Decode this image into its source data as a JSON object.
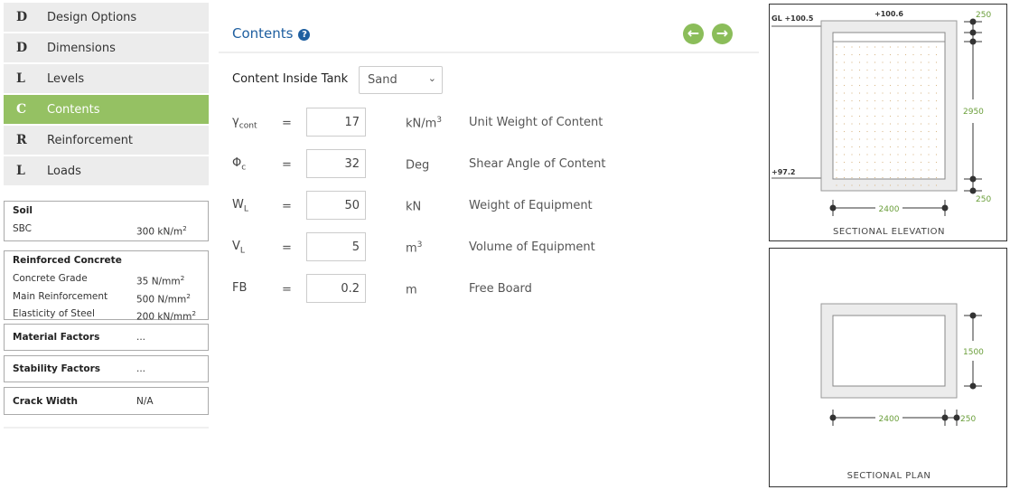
{
  "sidebar": {
    "items": [
      {
        "letter": "D",
        "label": "Design Options",
        "active": false
      },
      {
        "letter": "D",
        "label": "Dimensions",
        "active": false
      },
      {
        "letter": "L",
        "label": "Levels",
        "active": false
      },
      {
        "letter": "C",
        "label": "Contents",
        "active": true
      },
      {
        "letter": "R",
        "label": "Reinforcement",
        "active": false
      },
      {
        "letter": "L",
        "label": "Loads",
        "active": false
      }
    ],
    "soil": {
      "title": "Soil",
      "label": "SBC",
      "value": "300 kN/m",
      "sup": "2"
    },
    "rc": {
      "title": "Reinforced Concrete",
      "rows": [
        {
          "label": "Concrete Grade",
          "value": "35 N/mm",
          "sup": "2"
        },
        {
          "label": "Main Reinforcement",
          "value": "500 N/mm",
          "sup": "2"
        },
        {
          "label": "Elasticity of Steel",
          "value": "200 kN/mm",
          "sup": "2"
        }
      ]
    },
    "material": {
      "title": "Material Factors",
      "value": "..."
    },
    "stability": {
      "title": "Stability Factors",
      "value": "..."
    },
    "crack": {
      "title": "Crack Width",
      "value": "N/A"
    }
  },
  "main": {
    "title": "Contents",
    "help_icon": "question-circle-icon",
    "prev_icon": "arrow-left-circle-icon",
    "next_icon": "arrow-right-circle-icon",
    "accent": "#95c163",
    "title_color": "#1f5fa0",
    "content_label": "Content Inside Tank",
    "content_value": "Sand",
    "fields": [
      {
        "sym": "γ",
        "sub": "cont",
        "value": "17",
        "unit": "kN/m",
        "unit_sup": "3",
        "desc": "Unit Weight of Content"
      },
      {
        "sym": "Φ",
        "sub": "c",
        "value": "32",
        "unit": "Deg",
        "unit_sup": "",
        "desc": "Shear Angle of Content"
      },
      {
        "sym": "W",
        "sub": "L",
        "value": "50",
        "unit": "kN",
        "unit_sup": "",
        "desc": "Weight of Equipment"
      },
      {
        "sym": "V",
        "sub": "L",
        "value": "5",
        "unit": "m",
        "unit_sup": "3",
        "desc": "Volume of Equipment"
      },
      {
        "sym": "FB",
        "sub": "",
        "value": "0.2",
        "unit": "m",
        "unit_sup": "",
        "desc": "Free Board"
      }
    ],
    "eq": "="
  },
  "elevation": {
    "title": "SECTIONAL ELEVATION",
    "gl": "GL +100.5",
    "top": "+100.6",
    "bottom": "+97.2",
    "wall_top": "250",
    "height": "2950",
    "base": "250",
    "width": "2400"
  },
  "plan": {
    "title": "SECTIONAL PLAN",
    "depth": "1500",
    "width": "2400",
    "wall": "250"
  }
}
